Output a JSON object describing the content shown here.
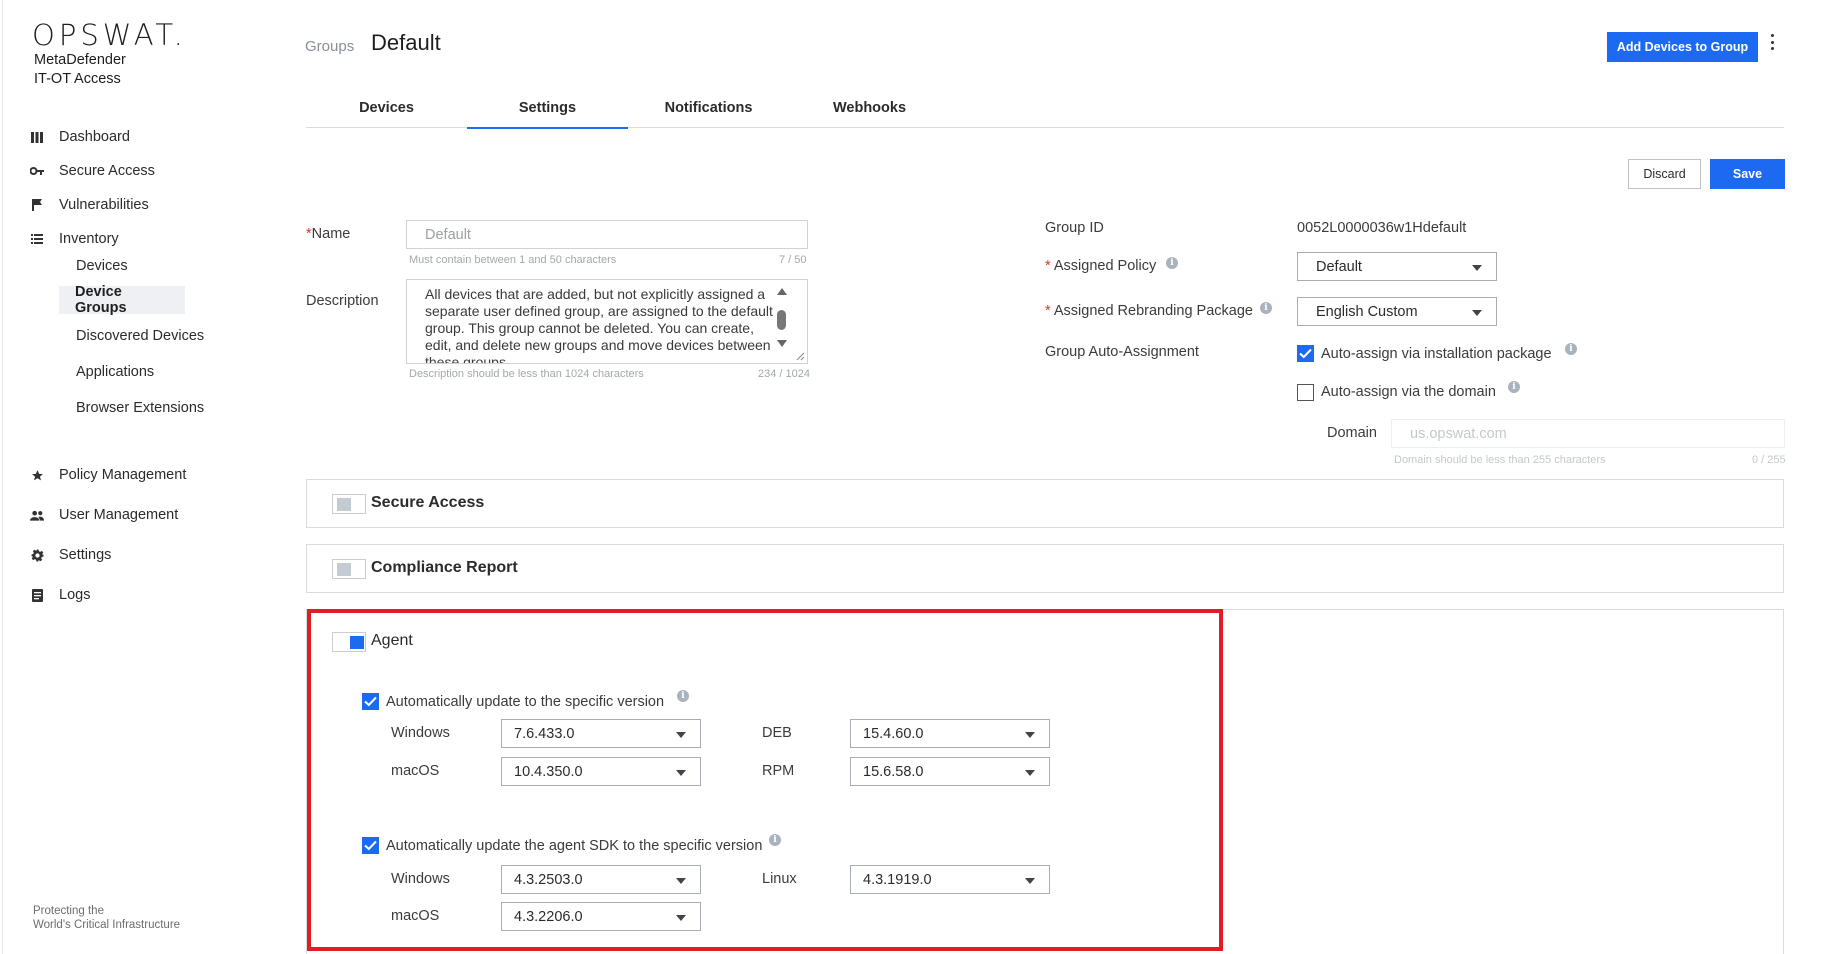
{
  "brand": {
    "logo_text": "OPSWAT.",
    "product_line1": "MetaDefender",
    "product_line2": "IT-OT Access",
    "footer_line1": "Protecting the",
    "footer_line2": "World's Critical Infrastructure"
  },
  "sidebar": {
    "items": [
      {
        "label": "Dashboard",
        "icon": "bar-chart-icon"
      },
      {
        "label": "Secure Access",
        "icon": "key-icon"
      },
      {
        "label": "Vulnerabilities",
        "icon": "flag-icon"
      },
      {
        "label": "Inventory",
        "icon": "list-icon"
      },
      {
        "label": "Policy Management",
        "icon": "star-icon"
      },
      {
        "label": "User Management",
        "icon": "users-icon"
      },
      {
        "label": "Settings",
        "icon": "gear-icon"
      },
      {
        "label": "Logs",
        "icon": "document-icon"
      }
    ],
    "inventory_sub": [
      "Devices",
      "Device Groups",
      "Discovered Devices",
      "Applications",
      "Browser Extensions"
    ],
    "active_sub": "Device Groups"
  },
  "header": {
    "breadcrumb": "Groups",
    "title": "Default",
    "add_button": "Add Devices to Group"
  },
  "tabs": [
    "Devices",
    "Settings",
    "Notifications",
    "Webhooks"
  ],
  "active_tab": "Settings",
  "actions": {
    "discard": "Discard",
    "save": "Save"
  },
  "form": {
    "name_label": "Name",
    "name_placeholder": "Default",
    "name_hint": "Must contain between 1 and 50 characters",
    "name_count": "7 / 50",
    "description_label": "Description",
    "description_value": "All devices that are added, but not explicitly assigned a separate user defined group, are assigned to the default group. This group cannot be deleted. You can create, edit, and delete new groups and move devices between these groups.",
    "description_hint": "Description should be less than 1024 characters",
    "description_count": "234 / 1024",
    "group_id_label": "Group ID",
    "group_id_value": "0052L0000036w1Hdefault",
    "assigned_policy_label": "Assigned Policy",
    "assigned_policy_value": "Default",
    "rebranding_label": "Assigned Rebranding Package",
    "rebranding_value": "English Custom",
    "auto_assign_label": "Group Auto-Assignment",
    "auto_install_label": "Auto-assign via installation package",
    "auto_install_checked": true,
    "auto_domain_label": "Auto-assign via the domain",
    "auto_domain_checked": false,
    "domain_label": "Domain",
    "domain_placeholder": "us.opswat.com",
    "domain_hint": "Domain should be less than 255 characters",
    "domain_count": "0 / 255"
  },
  "panels": {
    "secure_access": {
      "title": "Secure Access",
      "enabled": false
    },
    "compliance": {
      "title": "Compliance Report",
      "enabled": false
    },
    "agent": {
      "title": "Agent",
      "enabled": true
    }
  },
  "agent": {
    "auto_update_label": "Automatically update to the specific version",
    "auto_update_checked": true,
    "versions": {
      "windows_label": "Windows",
      "windows": "7.6.433.0",
      "macos_label": "macOS",
      "macos": "10.4.350.0",
      "deb_label": "DEB",
      "deb": "15.4.60.0",
      "rpm_label": "RPM",
      "rpm": "15.6.58.0"
    },
    "sdk_update_label": "Automatically update the agent SDK to the specific version",
    "sdk_update_checked": true,
    "sdk_versions": {
      "windows_label": "Windows",
      "windows": "4.3.2503.0",
      "macos_label": "macOS",
      "macos": "4.3.2206.0",
      "linux_label": "Linux",
      "linux": "4.3.1919.0"
    }
  },
  "colors": {
    "accent": "#1d6af2",
    "highlight": "#e01c24",
    "required": "#e0341e"
  }
}
